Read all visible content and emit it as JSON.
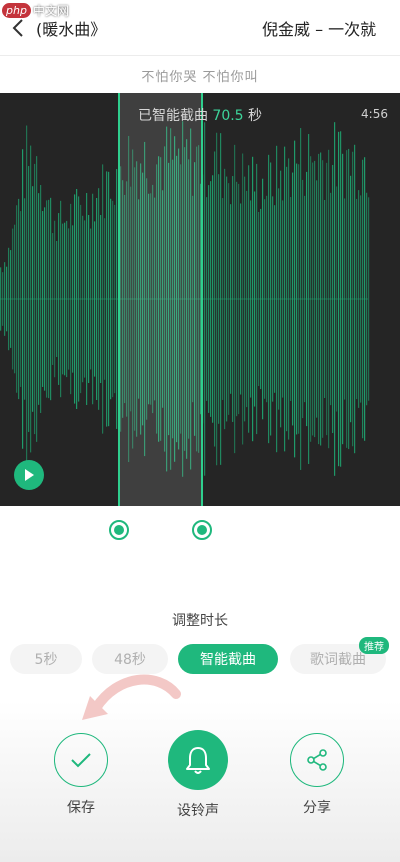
{
  "watermark": {
    "badge": "php",
    "site": "中文网"
  },
  "header": {
    "title_part1": "(暖水曲)",
    "title_part1_display": "《暖水曲)",
    "title_part2": "倪金威 – 一次就"
  },
  "lyrics": "不怕你哭  不怕你叫",
  "clip": {
    "prefix": "已智能截曲",
    "seconds": "70.5",
    "unit": "秒",
    "duration": "4:56",
    "selection_start_fraction": 0.3,
    "selection_end_fraction": 0.51
  },
  "adjust_label": "调整时长",
  "chips": [
    {
      "label": "5秒",
      "active": false
    },
    {
      "label": "48秒",
      "active": false
    },
    {
      "label": "智能截曲",
      "active": true
    },
    {
      "label": "歌词截曲",
      "active": false
    }
  ],
  "badge": "推荐",
  "actions": [
    {
      "label": "保存",
      "icon": "check-icon"
    },
    {
      "label": "设铃声",
      "icon": "bell-icon"
    },
    {
      "label": "分享",
      "icon": "share-icon"
    }
  ],
  "colors": {
    "accent": "#1fb87d",
    "waveform": "#1f9e6c",
    "panel": "#252525"
  }
}
